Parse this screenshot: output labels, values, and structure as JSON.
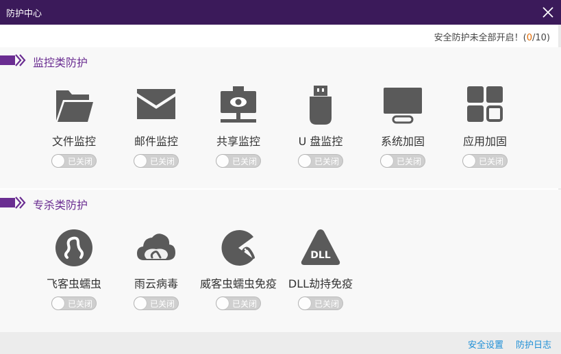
{
  "window": {
    "title": "防护中心",
    "close_icon": "close-icon"
  },
  "status": {
    "prefix": "安全防护未全部开启！(",
    "open_count": "0",
    "separator_total": "/10)"
  },
  "sections": [
    {
      "title": "监控类防护",
      "items": [
        {
          "label": "文件监控",
          "icon": "folder-icon",
          "toggle": "已关闭"
        },
        {
          "label": "邮件监控",
          "icon": "mail-icon",
          "toggle": "已关闭"
        },
        {
          "label": "共享监控",
          "icon": "network-share-icon",
          "toggle": "已关闭"
        },
        {
          "label": "U 盘监控",
          "icon": "usb-drive-icon",
          "toggle": "已关闭"
        },
        {
          "label": "系统加固",
          "icon": "monitor-icon",
          "toggle": "已关闭"
        },
        {
          "label": "应用加固",
          "icon": "apps-grid-icon",
          "toggle": "已关闭"
        }
      ]
    },
    {
      "title": "专杀类防护",
      "items": [
        {
          "label": "飞客虫蠕虫",
          "icon": "worm-circle-icon",
          "toggle": "已关闭"
        },
        {
          "label": "雨云病毒",
          "icon": "worm-cloud-icon",
          "toggle": "已关闭"
        },
        {
          "label": "威客虫蠕虫免疫",
          "icon": "pacman-worm-icon",
          "toggle": "已关闭"
        },
        {
          "label": "DLL劫持免疫",
          "icon": "dll-warning-icon",
          "toggle": "已关闭"
        }
      ]
    }
  ],
  "footer": {
    "settings_link": "安全设置",
    "log_link": "防护日志"
  },
  "colors": {
    "titlebar": "#3b1a5a",
    "accent_purple": "#6a2d91",
    "icon_gray": "#5a5a5a",
    "link_blue": "#1f8fd6",
    "count_orange": "#e26a00"
  }
}
